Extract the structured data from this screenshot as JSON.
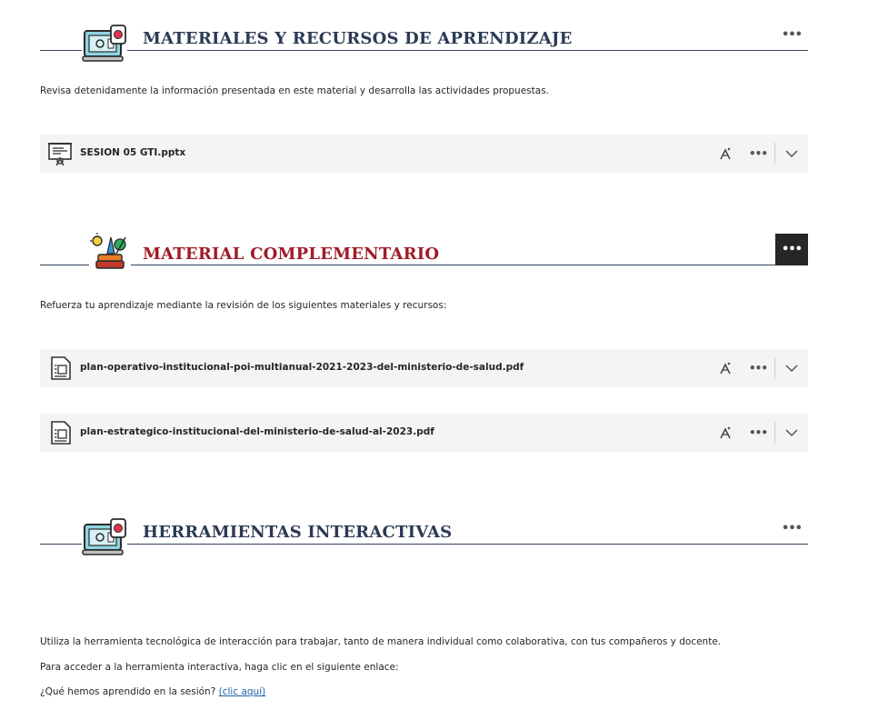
{
  "section1": {
    "title": "MATERIALES Y RECURSOS DE APRENDIZAJE",
    "more_label": "•••",
    "description": "Revisa detenidamente la información presentada en este material y desarrolla las actividades propuestas.",
    "files": [
      {
        "name": "SESION 05 GTI.pptx",
        "icon": "presentation-icon"
      }
    ]
  },
  "section2": {
    "title": "MATERIAL COMPLEMENTARIO",
    "more_label": "•••",
    "description": "Refuerza tu aprendizaje mediante la revisión de los siguientes materiales y recursos:",
    "files": [
      {
        "name": "plan-operativo-institucional-poi-multianual-2021-2023-del-ministerio-de-salud.pdf",
        "icon": "document-icon"
      },
      {
        "name": "plan-estrategico-institucional-del-ministerio-de-salud-al-2023.pdf",
        "icon": "document-icon"
      }
    ]
  },
  "section3": {
    "title": "HERRAMIENTAS INTERACTIVAS",
    "more_label": "•••",
    "paragraph1": "Utiliza la herramienta tecnológica de interacción para trabajar, tanto de manera individual como colaborativa, con tus compañeros y docente.",
    "paragraph2": "Para acceder a la herramienta interactiva, haga clic en el siguiente enlace:",
    "question_text": "¿Qué hemos aprendido en la sesión?",
    "link_text": "(clic aquí)"
  },
  "row_controls": {
    "more_label": "•••"
  },
  "colors": {
    "title_blue": "#2c3a55",
    "title_red": "#a01b27",
    "row_bg": "#f4f4f4",
    "link": "#1a62a8"
  }
}
